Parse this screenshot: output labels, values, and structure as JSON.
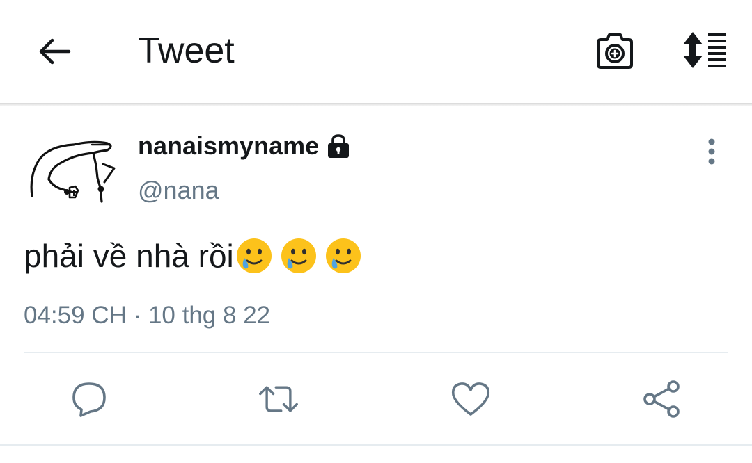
{
  "header": {
    "title": "Tweet",
    "back_icon": "arrow-left-icon",
    "camera_icon": "camera-plus-icon",
    "sort_icon": "sort-list-icon"
  },
  "tweet": {
    "display_name": "nanaismyname",
    "protected_icon": "lock-icon",
    "handle": "@nana",
    "text": "phải về nhà rồi",
    "emojis": [
      "smiling-face-with-tear",
      "smiling-face-with-tear",
      "smiling-face-with-tear"
    ],
    "timestamp": "04:59 CH · 10 thg 8 22",
    "more_icon": "more-vertical-icon"
  },
  "actions": [
    {
      "name": "reply",
      "icon": "reply-icon"
    },
    {
      "name": "retweet",
      "icon": "retweet-icon"
    },
    {
      "name": "like",
      "icon": "heart-icon"
    },
    {
      "name": "share",
      "icon": "share-icon"
    }
  ],
  "colors": {
    "text_primary": "#14171a",
    "text_secondary": "#657786",
    "icon_gray": "#657786",
    "divider": "#e6ecf0"
  }
}
